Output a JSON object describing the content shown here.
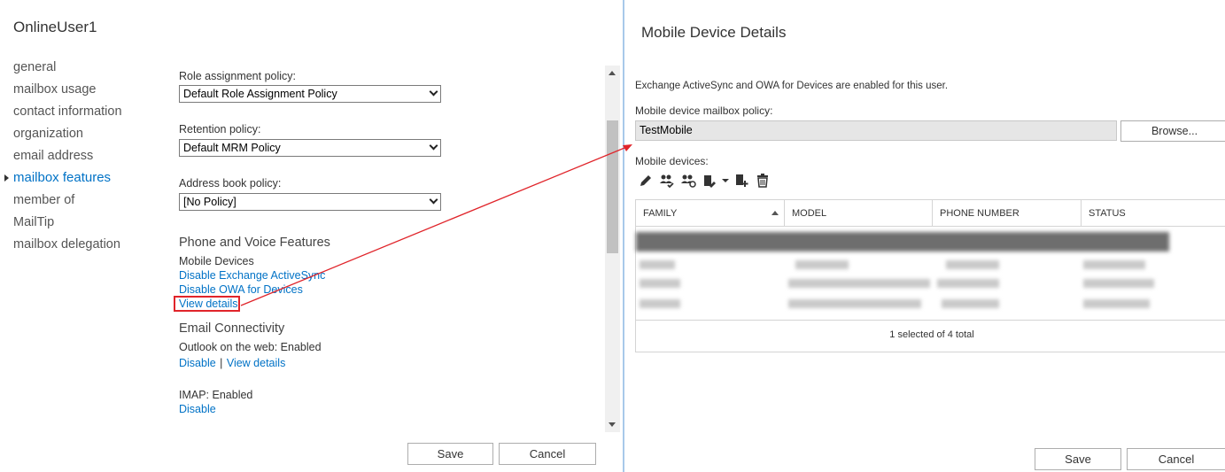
{
  "left": {
    "user_title": "OnlineUser1",
    "nav": [
      {
        "label": "general"
      },
      {
        "label": "mailbox usage"
      },
      {
        "label": "contact information"
      },
      {
        "label": "organization"
      },
      {
        "label": "email address"
      },
      {
        "label": "mailbox features",
        "selected": true
      },
      {
        "label": "member of"
      },
      {
        "label": "MailTip"
      },
      {
        "label": "mailbox delegation"
      }
    ],
    "role_assignment": {
      "label": "Role assignment policy:",
      "value": "Default Role Assignment Policy"
    },
    "retention": {
      "label": "Retention policy:",
      "value": "Default MRM Policy"
    },
    "address_book": {
      "label": "Address book policy:",
      "value": "[No Policy]"
    },
    "phone_voice": {
      "heading": "Phone and Voice Features",
      "mobile_devices": "Mobile Devices",
      "disable_activesync": "Disable Exchange ActiveSync",
      "disable_owa_devices": "Disable OWA for Devices",
      "view_details": "View details"
    },
    "email_connectivity": {
      "heading": "Email Connectivity",
      "owa_status": "Outlook on the web: Enabled",
      "disable": "Disable",
      "separator": "|",
      "view_details": "View details",
      "imap_status": "IMAP: Enabled",
      "imap_disable": "Disable"
    },
    "buttons": {
      "save": "Save",
      "cancel": "Cancel"
    }
  },
  "right": {
    "title": "Mobile Device Details",
    "info": "Exchange ActiveSync and OWA for Devices are enabled for this user.",
    "policy_label": "Mobile device mailbox policy:",
    "policy_value": "TestMobile",
    "browse": "Browse...",
    "devices_label": "Mobile devices:",
    "toolbar_icons": [
      "edit-icon",
      "allow-device-icon",
      "block-device-icon",
      "wipe-device-icon",
      "dropdown-chevron-icon",
      "add-device-icon",
      "delete-icon"
    ],
    "columns": [
      "FAMILY",
      "MODEL",
      "PHONE NUMBER",
      "STATUS"
    ],
    "status_text": "1 selected of 4 total",
    "buttons": {
      "save": "Save",
      "cancel": "Cancel"
    }
  },
  "colors": {
    "accent": "#0072c6",
    "annotation": "#e0242a",
    "panel_border": "#a8c9ea"
  }
}
